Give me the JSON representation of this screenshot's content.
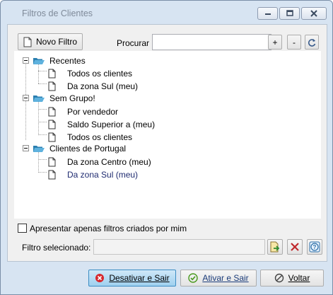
{
  "window": {
    "title": "Filtros de Clientes"
  },
  "toolbar": {
    "new_filter_label": "Novo Filtro",
    "search_label": "Procurar :",
    "search_value": "",
    "plus_label": "+",
    "minus_label": "-"
  },
  "tree": {
    "groups": [
      {
        "label": "Recentes",
        "items": [
          "Todos os clientes",
          "Da zona Sul (meu)"
        ]
      },
      {
        "label": "Sem Grupo!",
        "items": [
          "Por vendedor",
          "Saldo Superior a (meu)",
          "Todos os clientes"
        ]
      },
      {
        "label": "Clientes de Portugal",
        "items": [
          "Da zona Centro (meu)",
          "Da zona Sul (meu)"
        ]
      }
    ]
  },
  "options": {
    "only_mine_label": "Apresentar apenas filtros criados por mim",
    "only_mine_checked": false
  },
  "selection": {
    "label": "Filtro selecionado:",
    "value": ""
  },
  "footer": {
    "deactivate_label": "Desativar e Sair",
    "activate_label": "Ativar e Sair",
    "back_label": "Voltar"
  }
}
